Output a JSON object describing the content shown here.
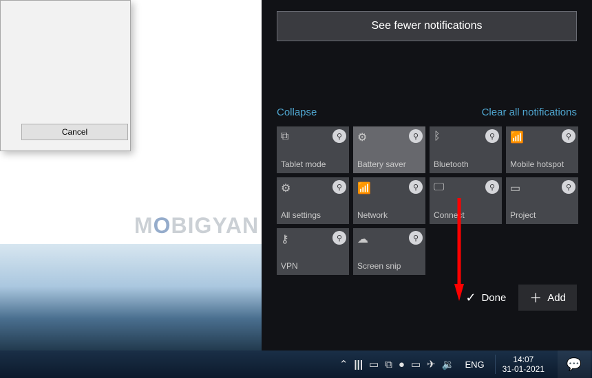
{
  "dialog": {
    "cancel_label": "Cancel"
  },
  "watermark": {
    "pre": "M",
    "mid": "O",
    "post": "BIGYAN"
  },
  "action_center": {
    "see_fewer_label": "See fewer notifications",
    "collapse_label": "Collapse",
    "clear_all_label": "Clear all notifications",
    "done_label": "Done",
    "add_label": "Add",
    "tiles": [
      {
        "label": "Tablet mode",
        "icon": "⧉",
        "name": "tile-tablet-mode"
      },
      {
        "label": "Battery saver",
        "icon": "⚙",
        "name": "tile-battery-saver",
        "hi": true
      },
      {
        "label": "Bluetooth",
        "icon": "ᛒ",
        "name": "tile-bluetooth"
      },
      {
        "label": "Mobile hotspot",
        "icon": "📶",
        "name": "tile-mobile-hotspot"
      },
      {
        "label": "All settings",
        "icon": "⚙",
        "name": "tile-all-settings"
      },
      {
        "label": "Network",
        "icon": "📶",
        "name": "tile-network"
      },
      {
        "label": "Connect",
        "icon": "🖵",
        "name": "tile-connect"
      },
      {
        "label": "Project",
        "icon": "▭",
        "name": "tile-project"
      },
      {
        "label": "VPN",
        "icon": "⚷",
        "name": "tile-vpn"
      },
      {
        "label": "Screen snip",
        "icon": "☁",
        "name": "tile-screen-snip"
      }
    ]
  },
  "taskbar": {
    "language": "ENG",
    "time": "14:07",
    "date": "31-01-2021",
    "icons": {
      "chevron_up": "⌃",
      "bars": "|||",
      "battery_tiny": "▭",
      "task_view": "⧉",
      "utorrent": "●",
      "battery": "▭",
      "airplane": "✈",
      "sound": "🔉",
      "notification": "💬"
    }
  }
}
